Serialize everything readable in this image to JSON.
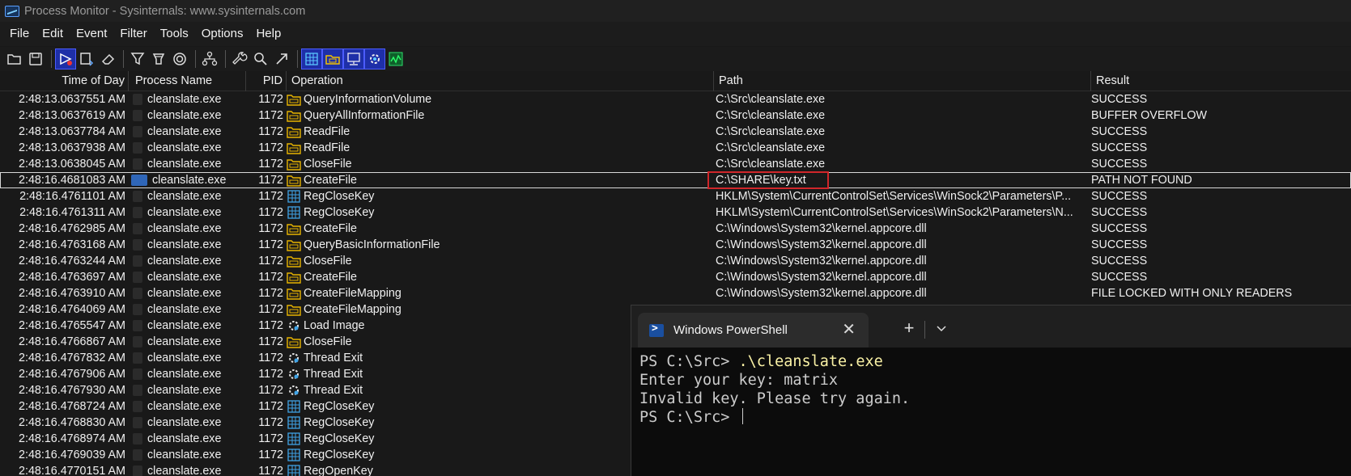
{
  "window": {
    "title": "Process Monitor - Sysinternals: www.sysinternals.com",
    "icon": "procmon-icon"
  },
  "menu": [
    "File",
    "Edit",
    "Event",
    "Filter",
    "Tools",
    "Options",
    "Help"
  ],
  "toolbar": [
    {
      "icon": "open-folder-icon"
    },
    {
      "icon": "save-icon"
    },
    {
      "icon": "capture-icon"
    },
    {
      "icon": "autoscroll-icon"
    },
    {
      "icon": "eraser-icon"
    },
    {
      "icon": "filter-icon"
    },
    {
      "icon": "highlight-icon"
    },
    {
      "icon": "target-icon"
    },
    {
      "icon": "process-tree-icon"
    },
    {
      "icon": "wrench-icon"
    },
    {
      "icon": "find-icon"
    },
    {
      "icon": "jump-icon"
    },
    {
      "icon": "registry-icon"
    },
    {
      "icon": "filesystem-icon"
    },
    {
      "icon": "network-icon"
    },
    {
      "icon": "process-thread-icon"
    },
    {
      "icon": "profiling-icon"
    }
  ],
  "columns": {
    "time": "Time of Day",
    "process": "Process Name",
    "pid": "PID",
    "operation": "Operation",
    "path": "Path",
    "result": "Result"
  },
  "rows": [
    {
      "time": "2:48:13.0637551 AM",
      "process": "cleanslate.exe",
      "pid": "1172",
      "op": "QueryInformationVolume",
      "icon": "file",
      "path": "C:\\Src\\cleanslate.exe",
      "result": "SUCCESS"
    },
    {
      "time": "2:48:13.0637619 AM",
      "process": "cleanslate.exe",
      "pid": "1172",
      "op": "QueryAllInformationFile",
      "icon": "file",
      "path": "C:\\Src\\cleanslate.exe",
      "result": "BUFFER OVERFLOW"
    },
    {
      "time": "2:48:13.0637784 AM",
      "process": "cleanslate.exe",
      "pid": "1172",
      "op": "ReadFile",
      "icon": "file",
      "path": "C:\\Src\\cleanslate.exe",
      "result": "SUCCESS"
    },
    {
      "time": "2:48:13.0637938 AM",
      "process": "cleanslate.exe",
      "pid": "1172",
      "op": "ReadFile",
      "icon": "file",
      "path": "C:\\Src\\cleanslate.exe",
      "result": "SUCCESS"
    },
    {
      "time": "2:48:13.0638045 AM",
      "process": "cleanslate.exe",
      "pid": "1172",
      "op": "CloseFile",
      "icon": "file",
      "path": "C:\\Src\\cleanslate.exe",
      "result": "SUCCESS"
    },
    {
      "time": "2:48:16.4681083 AM",
      "process": "cleanslate.exe",
      "pid": "1172",
      "op": "CreateFile",
      "icon": "file",
      "path": "C:\\SHARE\\key.txt",
      "result": "PATH NOT FOUND",
      "selected": true
    },
    {
      "time": "2:48:16.4761101 AM",
      "process": "cleanslate.exe",
      "pid": "1172",
      "op": "RegCloseKey",
      "icon": "reg",
      "path": "HKLM\\System\\CurrentControlSet\\Services\\WinSock2\\Parameters\\P...",
      "result": "SUCCESS"
    },
    {
      "time": "2:48:16.4761311 AM",
      "process": "cleanslate.exe",
      "pid": "1172",
      "op": "RegCloseKey",
      "icon": "reg",
      "path": "HKLM\\System\\CurrentControlSet\\Services\\WinSock2\\Parameters\\N...",
      "result": "SUCCESS"
    },
    {
      "time": "2:48:16.4762985 AM",
      "process": "cleanslate.exe",
      "pid": "1172",
      "op": "CreateFile",
      "icon": "file",
      "path": "C:\\Windows\\System32\\kernel.appcore.dll",
      "result": "SUCCESS"
    },
    {
      "time": "2:48:16.4763168 AM",
      "process": "cleanslate.exe",
      "pid": "1172",
      "op": "QueryBasicInformationFile",
      "icon": "file",
      "path": "C:\\Windows\\System32\\kernel.appcore.dll",
      "result": "SUCCESS"
    },
    {
      "time": "2:48:16.4763244 AM",
      "process": "cleanslate.exe",
      "pid": "1172",
      "op": "CloseFile",
      "icon": "file",
      "path": "C:\\Windows\\System32\\kernel.appcore.dll",
      "result": "SUCCESS"
    },
    {
      "time": "2:48:16.4763697 AM",
      "process": "cleanslate.exe",
      "pid": "1172",
      "op": "CreateFile",
      "icon": "file",
      "path": "C:\\Windows\\System32\\kernel.appcore.dll",
      "result": "SUCCESS"
    },
    {
      "time": "2:48:16.4763910 AM",
      "process": "cleanslate.exe",
      "pid": "1172",
      "op": "CreateFileMapping",
      "icon": "file",
      "path": "C:\\Windows\\System32\\kernel.appcore.dll",
      "result": "FILE LOCKED WITH ONLY READERS"
    },
    {
      "time": "2:48:16.4764069 AM",
      "process": "cleanslate.exe",
      "pid": "1172",
      "op": "CreateFileMapping",
      "icon": "file",
      "path": "",
      "result": ""
    },
    {
      "time": "2:48:16.4765547 AM",
      "process": "cleanslate.exe",
      "pid": "1172",
      "op": "Load Image",
      "icon": "gear",
      "path": "",
      "result": ""
    },
    {
      "time": "2:48:16.4766867 AM",
      "process": "cleanslate.exe",
      "pid": "1172",
      "op": "CloseFile",
      "icon": "file",
      "path": "",
      "result": ""
    },
    {
      "time": "2:48:16.4767832 AM",
      "process": "cleanslate.exe",
      "pid": "1172",
      "op": "Thread Exit",
      "icon": "gear",
      "path": "",
      "result": ""
    },
    {
      "time": "2:48:16.4767906 AM",
      "process": "cleanslate.exe",
      "pid": "1172",
      "op": "Thread Exit",
      "icon": "gear",
      "path": "",
      "result": ""
    },
    {
      "time": "2:48:16.4767930 AM",
      "process": "cleanslate.exe",
      "pid": "1172",
      "op": "Thread Exit",
      "icon": "gear",
      "path": "",
      "result": ""
    },
    {
      "time": "2:48:16.4768724 AM",
      "process": "cleanslate.exe",
      "pid": "1172",
      "op": "RegCloseKey",
      "icon": "reg",
      "path": "",
      "result": ""
    },
    {
      "time": "2:48:16.4768830 AM",
      "process": "cleanslate.exe",
      "pid": "1172",
      "op": "RegCloseKey",
      "icon": "reg",
      "path": "",
      "result": ""
    },
    {
      "time": "2:48:16.4768974 AM",
      "process": "cleanslate.exe",
      "pid": "1172",
      "op": "RegCloseKey",
      "icon": "reg",
      "path": "",
      "result": ""
    },
    {
      "time": "2:48:16.4769039 AM",
      "process": "cleanslate.exe",
      "pid": "1172",
      "op": "RegCloseKey",
      "icon": "reg",
      "path": "",
      "result": ""
    },
    {
      "time": "2:48:16.4770151 AM",
      "process": "cleanslate.exe",
      "pid": "1172",
      "op": "RegOpenKey",
      "icon": "reg",
      "path": "",
      "result": ""
    }
  ],
  "powershell": {
    "tab_title": "Windows PowerShell",
    "close_glyph": "✕",
    "new_tab_glyph": "+",
    "lines": [
      {
        "prompt": "PS C:\\Src> ",
        "command": ".\\cleanslate.exe"
      },
      {
        "text": "Enter your key: matrix"
      },
      {
        "text": "Invalid key. Please try again."
      },
      {
        "prompt": "PS C:\\Src> ",
        "cursor": true
      }
    ]
  },
  "colors": {
    "highlight_box": "#d0262a",
    "file_icon": "#e8b400",
    "reg_icon": "#3fa3e6",
    "active_toolbar": "#1e2fa8"
  }
}
